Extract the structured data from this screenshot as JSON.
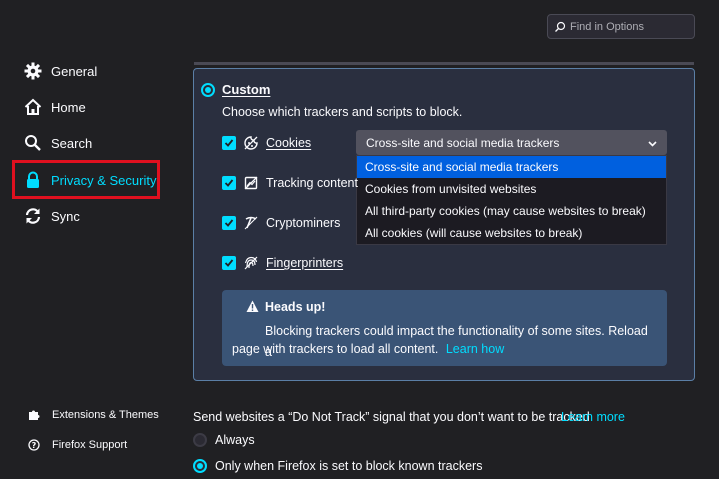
{
  "search": {
    "placeholder": "Find in Options",
    "icon": "search-icon"
  },
  "sidebar": {
    "items": [
      {
        "label": "General",
        "icon": "gear-icon"
      },
      {
        "label": "Home",
        "icon": "home-icon"
      },
      {
        "label": "Search",
        "icon": "search-icon"
      },
      {
        "label": "Privacy & Security",
        "icon": "lock-icon",
        "selected": true
      },
      {
        "label": "Sync",
        "icon": "sync-icon"
      }
    ],
    "footer": [
      {
        "label": "Extensions & Themes",
        "icon": "puzzle-icon"
      },
      {
        "label": "Firefox Support",
        "icon": "help-icon"
      }
    ],
    "highlight_color": "#e0101f"
  },
  "custom": {
    "label": "Custom",
    "description": "Choose which trackers and scripts to block.",
    "trackers": [
      {
        "label": "Cookies",
        "icon": "cookie-icon",
        "checked": true
      },
      {
        "label": "Tracking content",
        "icon": "tracking-content-icon",
        "checked": true
      },
      {
        "label": "Cryptominers",
        "icon": "cryptominer-icon",
        "checked": true
      },
      {
        "label": "Fingerprinters",
        "icon": "fingerprint-icon",
        "checked": true
      }
    ],
    "cookies_select": {
      "value": "Cross-site and social media trackers",
      "options": [
        "Cross-site and social media trackers",
        "Cookies from unvisited websites",
        "All third-party cookies (may cause websites to break)",
        "All cookies (will cause websites to break)"
      ]
    },
    "heads_up": {
      "title": "Heads up!",
      "body_line1": "Blocking trackers could impact the functionality of some sites. Reload a",
      "body_line2": "page with trackers to load all content.",
      "link": "Learn how"
    }
  },
  "dnt": {
    "text": "Send websites a “Do Not Track” signal that you don’t want to be tracked",
    "link": "Learn more",
    "options": [
      {
        "label": "Always",
        "checked": false
      },
      {
        "label": "Only when Firefox is set to block known trackers",
        "checked": true
      }
    ]
  },
  "colors": {
    "accent": "#00ddff",
    "selected_option": "#0060df",
    "panel_border": "#5b7fa6"
  }
}
